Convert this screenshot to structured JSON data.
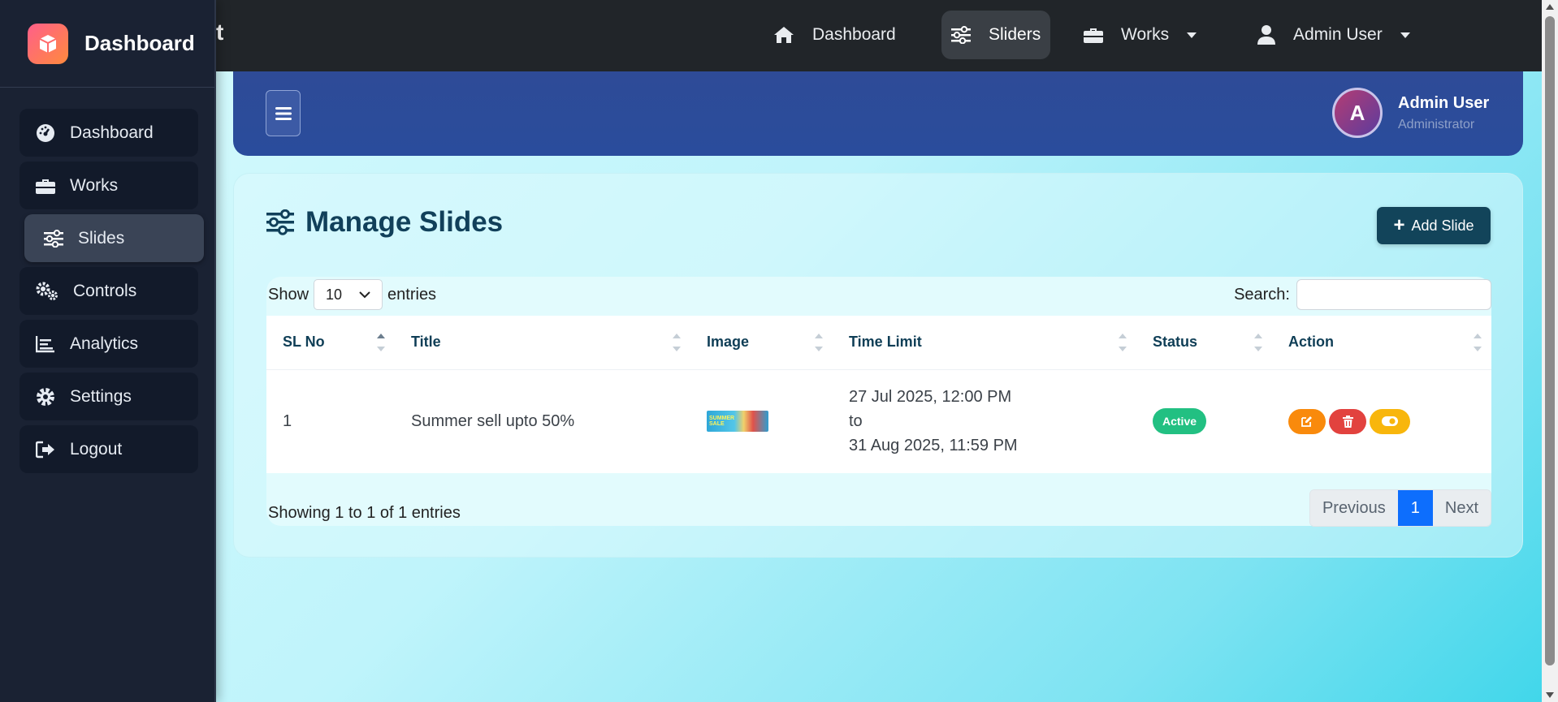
{
  "topnav": {
    "brand_peek": "t",
    "items": [
      {
        "label": "Dashboard",
        "icon": "home-icon"
      },
      {
        "label": "Sliders",
        "icon": "sliders-icon",
        "active": true
      },
      {
        "label": "Works",
        "icon": "briefcase-icon",
        "dropdown": true
      },
      {
        "label": "Admin User",
        "icon": "user-icon",
        "dropdown": true
      }
    ]
  },
  "sidebar": {
    "title": "Dashboard",
    "logo_icon": "cube-icon",
    "items": [
      {
        "label": "Dashboard",
        "icon": "gauge-icon"
      },
      {
        "label": "Works",
        "icon": "briefcase-icon"
      },
      {
        "label": "Slides",
        "icon": "sliders-icon",
        "active": true
      },
      {
        "label": "Controls",
        "icon": "gears-icon"
      },
      {
        "label": "Analytics",
        "icon": "chart-line-icon"
      },
      {
        "label": "Settings",
        "icon": "gear-icon"
      },
      {
        "label": "Logout",
        "icon": "logout-icon"
      }
    ]
  },
  "header": {
    "avatar_initial": "A",
    "user_name": "Admin User",
    "user_role": "Administrator"
  },
  "main": {
    "title": "Manage Slides",
    "add_button_label": "Add Slide",
    "show_label": "Show",
    "entries_value": "10",
    "entries_label": "entries",
    "search_label": "Search:",
    "search_value": "",
    "columns": [
      "SL No",
      "Title",
      "Image",
      "Time Limit",
      "Status",
      "Action"
    ],
    "rows": [
      {
        "sl_no": "1",
        "title": "Summer sell upto 50%",
        "image_caption": "SUMMER SALE",
        "time_start": "27 Jul 2025, 12:00 PM",
        "time_sep": "to",
        "time_end": "31 Aug 2025, 11:59 PM",
        "status": "Active"
      }
    ],
    "info": "Showing 1 to 1 of 1 entries",
    "pager": {
      "previous": "Previous",
      "current": "1",
      "next": "Next"
    }
  },
  "colors": {
    "topnav_bg": "#212529",
    "sidebar_bg": "#1a2233",
    "header_bg": "#2a4a96",
    "title_color": "#11405a",
    "add_button_bg": "#12445a",
    "status_active": "#22c082",
    "edit_button": "#f98a0c",
    "delete_button": "#e2423e",
    "toggle_button": "#f8b60c",
    "pager_current": "#0d6efd"
  }
}
